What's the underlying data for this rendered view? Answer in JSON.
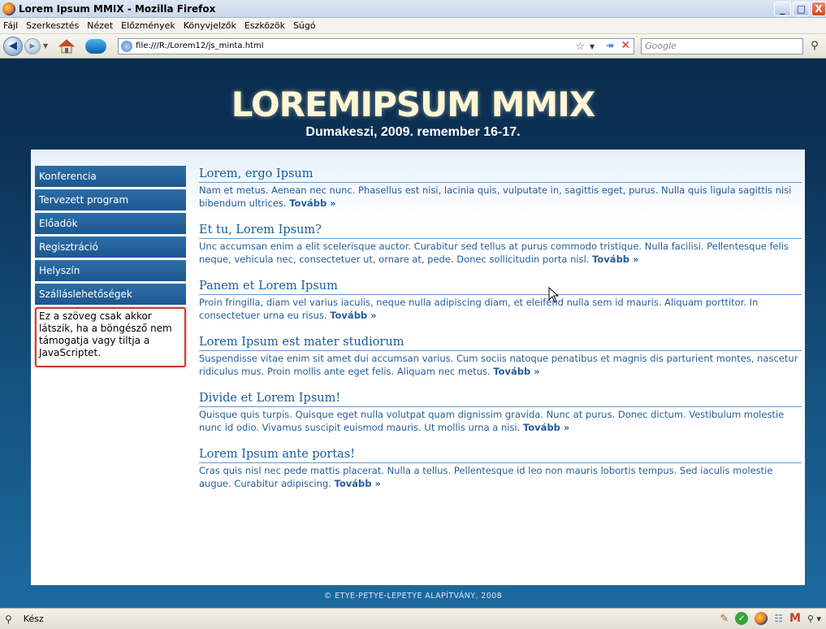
{
  "window": {
    "title": "Lorem Ipsum MMIX - Mozilla Firefox",
    "minimize": "_",
    "maximize": "□",
    "close": "X"
  },
  "menu": [
    "Fájl",
    "Szerkesztés",
    "Nézet",
    "Előzmények",
    "Könyvjelzők",
    "Eszközök",
    "Súgó"
  ],
  "navbar": {
    "url": "file:///R:/Lorem12/js_minta.html",
    "search_placeholder": "Google"
  },
  "page": {
    "title": "LOREMIPSUM MMIX",
    "subtitle": "Dumakeszi, 2009. remember 16-17.",
    "sidebar": [
      "Konferencia",
      "Tervezett program",
      "Előadók",
      "Regisztráció",
      "Helyszín",
      "Szálláslehetőségek"
    ],
    "noscript": "Ez a szöveg csak akkor látszik, ha a böngésző nem támogatja vagy tiltja a JavaScriptet.",
    "more": "Tovább »",
    "articles": [
      {
        "title": "Lorem, ergo Ipsum",
        "body": "Nam et metus. Aenean nec nunc. Phasellus est nisi, lacinia quis, vulputate in, sagittis eget, purus. Nulla quis ligula sagittis nisi bibendum ultrices."
      },
      {
        "title": "Et tu, Lorem Ipsum?",
        "body": "Unc accumsan enim a elit scelerisque auctor. Curabitur sed tellus at purus commodo tristique. Nulla facilisi. Pellentesque felis neque, vehicula nec, consectetuer ut, ornare at, pede. Donec sollicitudin porta nisl."
      },
      {
        "title": "Panem et Lorem Ipsum",
        "body": "Proin fringilla, diam vel varius iaculis, neque nulla adipiscing diam, et eleifend nulla sem id mauris. Aliquam porttitor. In consectetuer urna eu risus."
      },
      {
        "title": "Lorem Ipsum est mater studiorum",
        "body": "Suspendisse vitae enim sit amet dui accumsan varius. Cum sociis natoque penatibus et magnis dis parturient montes, nascetur ridiculus mus. Proin mollis ante eget felis. Aliquam nec metus."
      },
      {
        "title": "Divide et Lorem Ipsum!",
        "body": "Quisque quis turpis. Quisque eget nulla volutpat quam dignissim gravida. Nunc at purus. Donec dictum. Vestibulum molestie nunc id odio. Vivamus suscipit euismod mauris. Ut mollis urna a nisi."
      },
      {
        "title": "Lorem Ipsum ante portas!",
        "body": "Cras quis nisl nec pede mattis placerat. Nulla a tellus. Pellentesque id leo non mauris lobortis tempus. Sed iaculis molestie augue. Curabitur adipiscing."
      }
    ],
    "footer": "© ETYE-PETYE-LEPETYE ALAPÍTVÁNY, 2008"
  },
  "status": {
    "text": "Kész"
  }
}
